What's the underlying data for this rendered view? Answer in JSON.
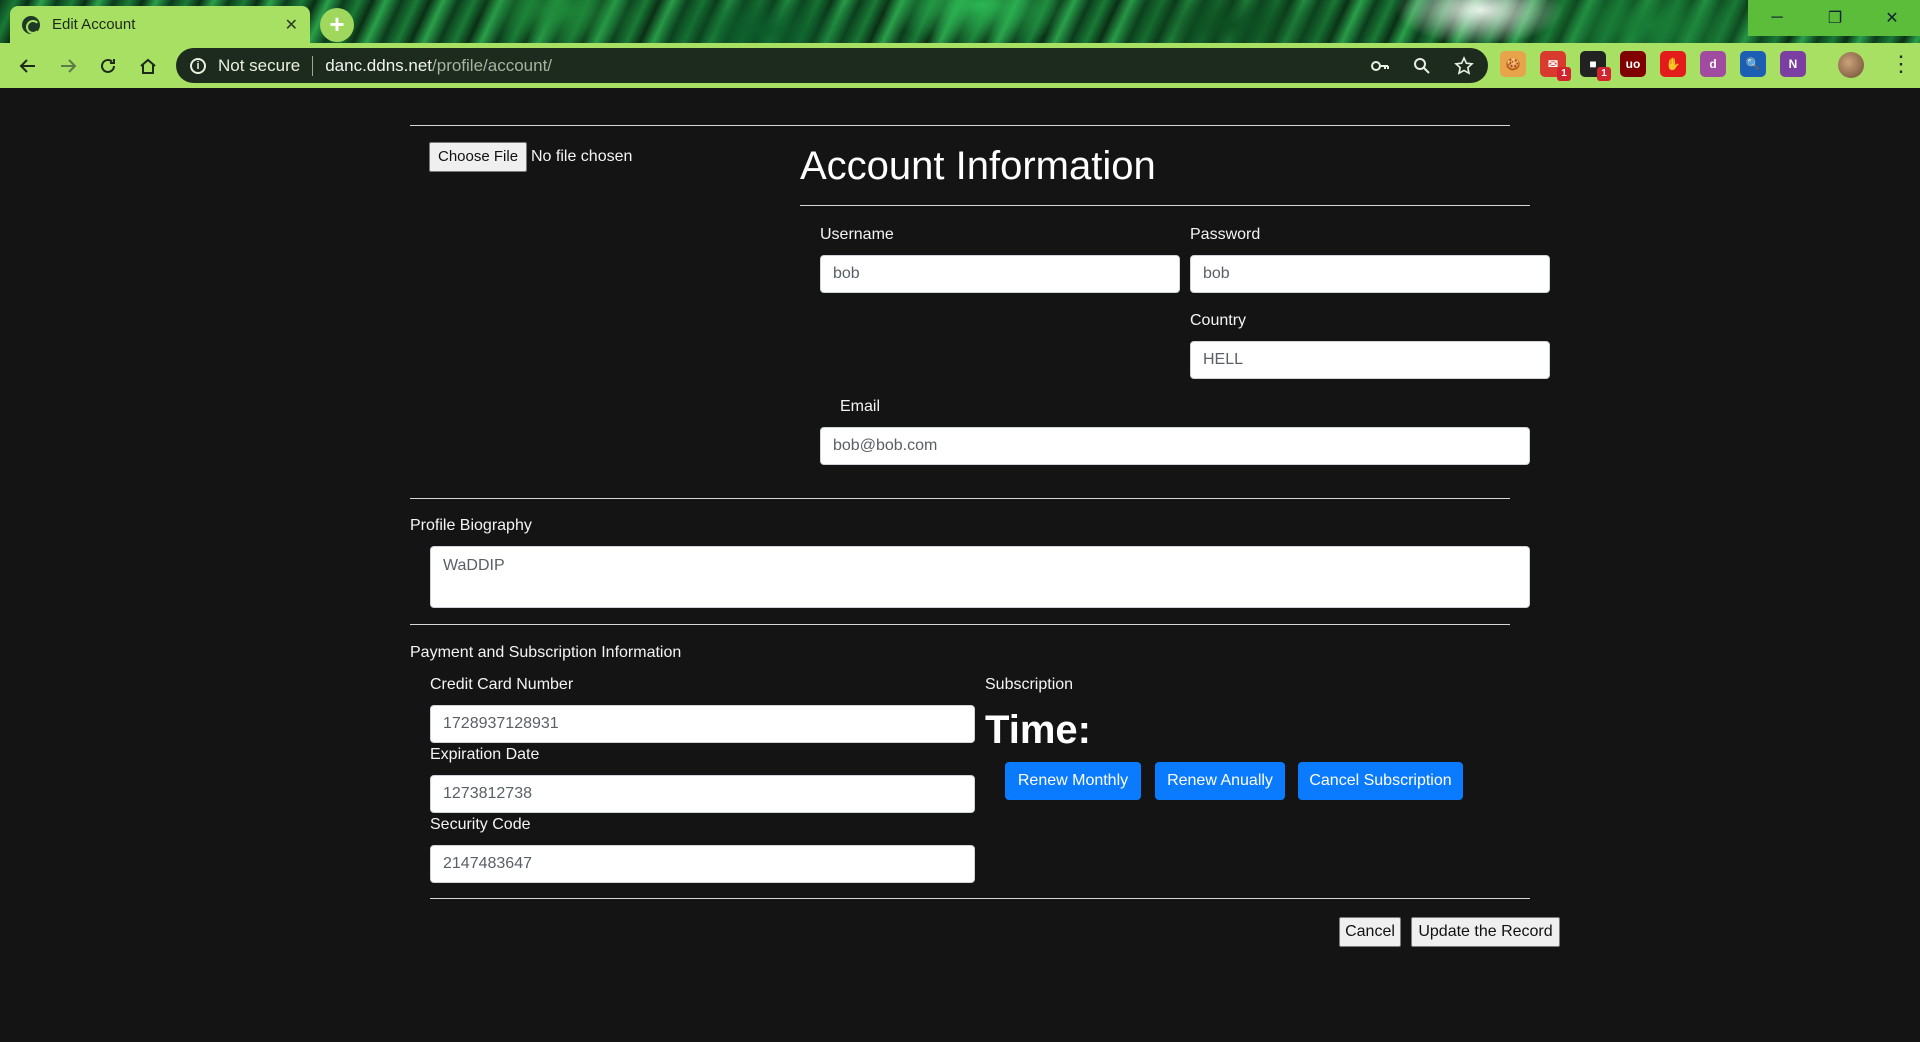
{
  "browser": {
    "tab_title": "Edit Account",
    "tab_close": "✕",
    "new_tab": "+",
    "omnibox": {
      "security_label": "Not secure",
      "url_host": "danc.ddns.net",
      "url_path": "/profile/account/"
    },
    "window_controls": {
      "minimize": "─",
      "maximize": "❐",
      "close": "✕"
    },
    "extensions": [
      {
        "name": "cookie-extension-icon",
        "glyph": "🍪",
        "color": "#e7a44a",
        "badge": ""
      },
      {
        "name": "mail-extension-icon",
        "glyph": "✉",
        "color": "#d83a2e",
        "badge": "1"
      },
      {
        "name": "chat-extension-icon",
        "glyph": "■",
        "color": "#222222",
        "badge": "1"
      },
      {
        "name": "ublock-extension-icon",
        "glyph": "uo",
        "color": "#800000",
        "badge": ""
      },
      {
        "name": "adblock-extension-icon",
        "glyph": "✋",
        "color": "#e31b1b",
        "badge": ""
      },
      {
        "name": "d-extension-icon",
        "glyph": "d",
        "color": "#a04aa0",
        "badge": ""
      },
      {
        "name": "search-extension-icon",
        "glyph": "🔍",
        "color": "#1a5fb4",
        "badge": ""
      },
      {
        "name": "onenote-extension-icon",
        "glyph": "N",
        "color": "#7a3fa0",
        "badge": ""
      }
    ]
  },
  "page": {
    "file_upload": {
      "button_label": "Choose File",
      "status": "No file chosen"
    },
    "account": {
      "heading": "Account Information",
      "username_label": "Username",
      "username_value": "bob",
      "password_label": "Password",
      "password_value": "bob",
      "country_label": "Country",
      "country_value": "HELL",
      "email_label": "Email",
      "email_value": "bob@bob.com"
    },
    "biography": {
      "label": "Profile Biography",
      "value": "WaDDIP"
    },
    "payment": {
      "section_label": "Payment and Subscription Information",
      "card_label": "Credit Card Number",
      "card_value": "1728937128931",
      "expiration_label": "Expiration Date",
      "expiration_value": "1273812738",
      "security_label": "Security Code",
      "security_value": "2147483647",
      "subscription_label": "Subscription",
      "time_heading": "Time:",
      "renew_monthly": "Renew Monthly",
      "renew_annually": "Renew Anually",
      "cancel_subscription": "Cancel Subscription"
    },
    "actions": {
      "cancel": "Cancel",
      "update": "Update the Record"
    }
  }
}
